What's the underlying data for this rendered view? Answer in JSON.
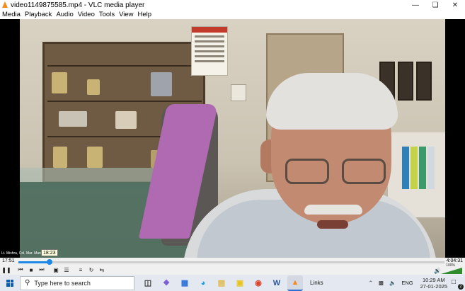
{
  "window": {
    "title": "video1149875585.mp4 - VLC media player",
    "minimize_icon": "minimize-icon",
    "maximize_icon": "restore-icon",
    "close_icon": "close-icon"
  },
  "menu": [
    "Media",
    "Playback",
    "Audio",
    "Video",
    "Tools",
    "View",
    "Help"
  ],
  "video": {
    "caption": "Lt. Mishra, Col. Mar. Manipal"
  },
  "playback": {
    "elapsed": "17:51",
    "total": "4:04:31",
    "hover_time": "18:23",
    "progress": 0.073,
    "accent": "#1e88e5"
  },
  "controls": {
    "buttons": [
      "pause-icon",
      "previous-icon",
      "stop-icon",
      "next-icon",
      "fullscreen-icon",
      "extended-settings-icon",
      "playlist-icon",
      "loop-icon",
      "shuffle-icon"
    ],
    "volume_percent": "100%",
    "volume_level": 1.0
  },
  "taskbar": {
    "search_placeholder": "Type here to search",
    "apps": [
      "task-view-icon",
      "copilot-icon",
      "store-icon",
      "edge-icon",
      "file-explorer-icon",
      "sticky-notes-icon",
      "chrome-icon",
      "word-icon",
      "vlc-icon"
    ],
    "links_label": "Links",
    "language": "ENG",
    "time": "10:29 AM",
    "date": "27-01-2025",
    "notification_count": "2"
  }
}
